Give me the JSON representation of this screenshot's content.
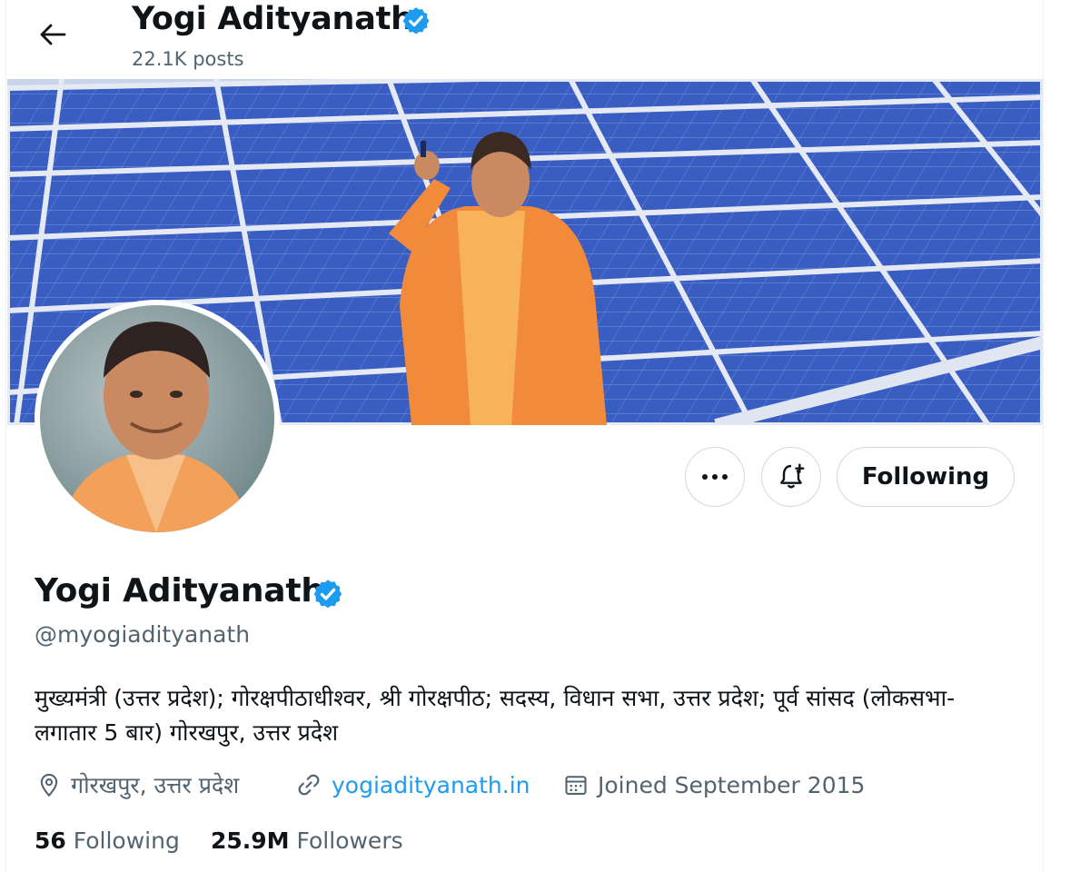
{
  "header": {
    "name": "Yogi Adityanath",
    "posts": "22.1K posts",
    "back_icon": "arrow-left-icon",
    "verified_icon": "verified-badge-icon"
  },
  "banner": {
    "description_icon": "solar-panels-banner"
  },
  "actions": {
    "more_icon": "more-dots-icon",
    "notify_icon": "bell-plus-icon",
    "follow_label": "Following"
  },
  "profile": {
    "name": "Yogi Adityanath",
    "handle": "@myogiadityanath",
    "bio": "मुख्यमंत्री (उत्तर प्रदेश); गोरक्षपीठाधीश्वर, श्री गोरक्षपीठ; सदस्य, विधान सभा, उत्तर प्रदेश; पूर्व सांसद (लोकसभा-लगातार 5 बार) गोरखपुर, उत्तर प्रदेश",
    "location": "गोरखपुर, उत्तर प्रदेश",
    "website": "yogiadityanath.in",
    "joined": "Joined September 2015",
    "following_count": "56",
    "following_label": "Following",
    "followers_count": "25.9M",
    "followers_label": "Followers"
  },
  "colors": {
    "accent": "#1d9bf0",
    "text": "#0f1419",
    "muted": "#536471",
    "border": "#cfd9de",
    "saffron": "#f28a3c"
  }
}
